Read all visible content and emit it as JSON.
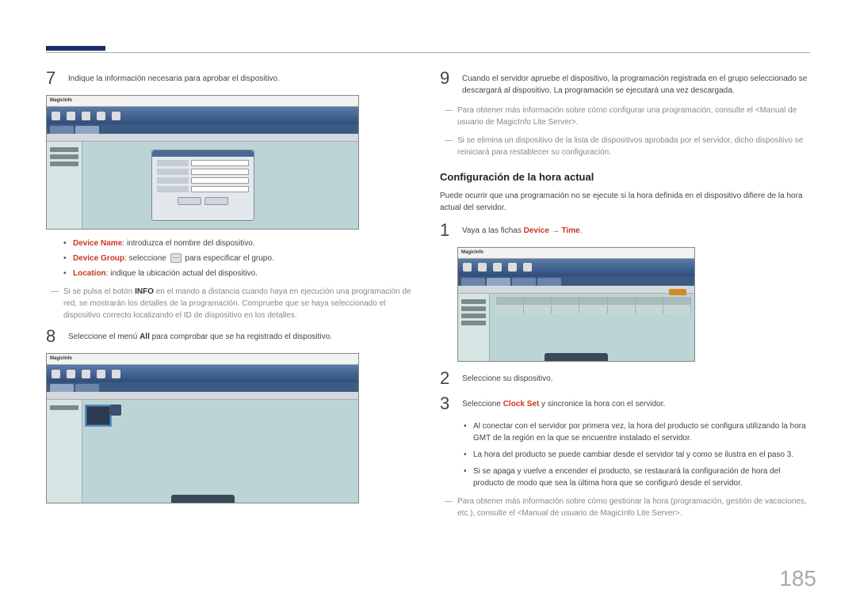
{
  "page_number": "185",
  "left": {
    "step7": {
      "num": "7",
      "text": "Indique la información necesaria para aprobar el dispositivo."
    },
    "bullets": [
      {
        "label": "Device Name",
        "rest": ": introduzca el nombre del dispositivo."
      },
      {
        "label": "Device Group",
        "rest_prefix": ": seleccione ",
        "rest_suffix": " para especificar el grupo."
      },
      {
        "label": "Location",
        "rest": ": indique la ubicación actual del dispositivo."
      }
    ],
    "note1_prefix": "Si se pulsa el botón ",
    "note1_bold": "INFO",
    "note1_suffix": " en el mando a distancia cuando haya en ejecución una programación de red, se mostrarán los detalles de la programación. Compruebe que se haya seleccionado el dispositivo correcto localizando el ID de dispositivo en los detalles.",
    "step8": {
      "num": "8",
      "text_prefix": "Seleccione el menú ",
      "text_bold": "All",
      "text_suffix": " para comprobar que se ha registrado el dispositivo."
    }
  },
  "right": {
    "step9": {
      "num": "9",
      "text": "Cuando el servidor apruebe el dispositivo, la programación registrada en el grupo seleccionado se descargará al dispositivo. La programación se ejecutará una vez descargada."
    },
    "note_a": "Para obtener más información sobre cómo configurar una programación, consulte el <Manual de usuario de MagicInfo Lite Server>.",
    "note_b": "Si se elimina un dispositivo de la lista de dispositivos aprobada por el servidor, dicho dispositivo se reiniciará para restablecer su configuración.",
    "section_title": "Configuración de la hora actual",
    "section_desc": "Puede ocurrir que una programación no se ejecute si la hora definida en el dispositivo difiere de la hora actual del servidor.",
    "step1": {
      "num": "1",
      "prefix": "Vaya a las fichas ",
      "red1": "Device",
      "arrow": " → ",
      "red2": "Time",
      "suffix": "."
    },
    "step2": {
      "num": "2",
      "text": "Seleccione su dispositivo."
    },
    "step3": {
      "num": "3",
      "prefix": "Seleccione ",
      "red": "Clock Set",
      "suffix": " y sincronice la hora con el servidor."
    },
    "bullets": [
      "Al conectar con el servidor por primera vez, la hora del producto se configura utilizando la hora GMT de la región en la que se encuentre instalado el servidor.",
      "La hora del producto se puede cambiar desde el servidor tal y como se ilustra en el paso 3.",
      "Si se apaga y vuelve a encender el producto, se restaurará la configuración de hora del producto de modo que sea la última hora que se configuró desde el servidor."
    ],
    "note_final": "Para obtener más información sobre cómo gestionar la hora (programación, gestión de vacaciones, etc.), consulte el <Manual de usuario de MagicInfo Lite Server>."
  },
  "screenshots": {
    "logo": "MagicInfo"
  }
}
